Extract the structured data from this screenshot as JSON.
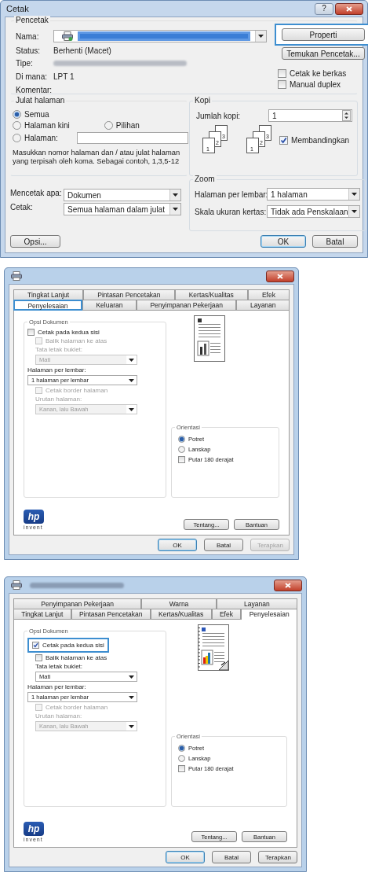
{
  "print_dialog": {
    "title": "Cetak",
    "help_button": "?",
    "printer": {
      "legend": "Pencetak",
      "name_label": "Nama:",
      "status_label": "Status:",
      "status": "Berhenti (Macet)",
      "type_label": "Tipe:",
      "where_label": "Di mana:",
      "where": "LPT 1",
      "comment_label": "Komentar:"
    },
    "side_buttons": [
      {
        "label": "Properti",
        "callout": true
      },
      {
        "label": "Temukan Pencetak...",
        "callout": false
      }
    ],
    "side_options": [
      {
        "label": "Cetak ke berkas",
        "checked": false
      },
      {
        "label": "Manual duplex",
        "checked": false
      }
    ],
    "page_range": {
      "legend": "Julat halaman",
      "options": [
        {
          "label": "Semua",
          "selected": true
        },
        {
          "label": "Halaman kini",
          "selected": false
        },
        {
          "label": "Pilihan",
          "selected": false
        },
        {
          "label": "Halaman:",
          "selected": false
        }
      ],
      "hint": "Masukkan nomor halaman dan / atau julat halaman yang terpisah oleh koma. Sebagai contoh, 1,3,5-12"
    },
    "copies": {
      "legend": "Kopi",
      "count_label": "Jumlah kopi:",
      "count": "1",
      "stacks": [
        [
          "3",
          "2",
          "1"
        ],
        [
          "3",
          "2",
          "1"
        ]
      ],
      "collate": {
        "label": "Membandingkan",
        "checked": true
      }
    },
    "print_what": [
      {
        "label": "Mencetak apa:",
        "value": "Dokumen"
      },
      {
        "label": "Cetak:",
        "value": "Semua halaman dalam julat"
      }
    ],
    "zoom": {
      "legend": "Zoom",
      "rows": [
        {
          "label": "Halaman per lembar:",
          "value": "1 halaman"
        },
        {
          "label": "Skala ukuran kertas:",
          "value": "Tidak ada Penskalaan"
        }
      ]
    },
    "options_button": "Opsi...",
    "buttons": [
      {
        "label": "OK",
        "default": true
      },
      {
        "label": "Batal",
        "default": false
      }
    ]
  },
  "properties_dialogs": [
    {
      "title_redacted": false,
      "tab_rows": [
        [
          {
            "label": "Tingkat Lanjut",
            "selected": false,
            "callout": false
          },
          {
            "label": "Pintasan Pencetakan",
            "selected": false,
            "callout": false
          },
          {
            "label": "Kertas/Kualitas",
            "selected": false,
            "callout": false
          },
          {
            "label": "Efek",
            "selected": false,
            "callout": false
          }
        ],
        [
          {
            "label": "Penyelesaian",
            "selected": true,
            "callout": true
          },
          {
            "label": "Keluaran",
            "selected": false,
            "callout": false
          },
          {
            "label": "Penyimpanan Pekerjaan",
            "selected": false,
            "callout": false
          },
          {
            "label": "Layanan",
            "selected": false,
            "callout": false
          }
        ]
      ],
      "doc_options": {
        "legend": "Opsi Dokumen",
        "items": [
          {
            "kind": "checkbox",
            "label": "Cetak pada kedua sisi",
            "checked": false,
            "disabled": false,
            "callout": false,
            "children": [
              {
                "kind": "checkbox",
                "label": "Balik halaman ke atas",
                "checked": false,
                "disabled": true
              },
              {
                "kind": "label",
                "label": "Tata letak buklet:",
                "disabled": true
              },
              {
                "kind": "select",
                "value": "Mati",
                "disabled": true
              }
            ]
          },
          {
            "kind": "label",
            "label": "Halaman per lembar:",
            "disabled": false
          },
          {
            "kind": "select",
            "value": "1 halaman per lembar",
            "disabled": false,
            "children": [
              {
                "kind": "checkbox",
                "label": "Cetak border halaman",
                "checked": false,
                "disabled": true
              },
              {
                "kind": "label",
                "label": "Urutan halaman:",
                "disabled": true
              },
              {
                "kind": "select",
                "value": "Kanan, lalu Bawah",
                "disabled": true
              }
            ]
          }
        ]
      },
      "preview": {
        "kind": "mono"
      },
      "orientation": {
        "legend": "Orientasi",
        "options": [
          {
            "label": "Potret",
            "selected": true
          },
          {
            "label": "Lanskap",
            "selected": false
          }
        ],
        "rotate": {
          "label": "Putar 180 derajat",
          "checked": false
        }
      },
      "logo": {
        "mark": "hp",
        "tagline": "invent"
      },
      "info_buttons": [
        "Tentang...",
        "Bantuan"
      ],
      "buttons": [
        {
          "label": "OK",
          "default": true,
          "disabled": false
        },
        {
          "label": "Batal",
          "default": false,
          "disabled": false
        },
        {
          "label": "Terapkan",
          "default": false,
          "disabled": true
        }
      ]
    },
    {
      "title_redacted": true,
      "tab_rows": [
        [
          {
            "label": "Penyimpanan Pekerjaan",
            "selected": false,
            "callout": false
          },
          {
            "label": "Warna",
            "selected": false,
            "callout": false
          },
          {
            "label": "Layanan",
            "selected": false,
            "callout": false
          }
        ],
        [
          {
            "label": "Tingkat Lanjut",
            "selected": false,
            "callout": false
          },
          {
            "label": "Pintasan Pencetakan",
            "selected": false,
            "callout": false
          },
          {
            "label": "Kertas/Kualitas",
            "selected": false,
            "callout": false
          },
          {
            "label": "Efek",
            "selected": false,
            "callout": false
          },
          {
            "label": "Penyelesaian",
            "selected": true,
            "callout": false
          }
        ]
      ],
      "doc_options": {
        "legend": "Opsi Dokumen",
        "items": [
          {
            "kind": "checkbox",
            "label": "Cetak pada kedua sisi",
            "checked": true,
            "disabled": false,
            "callout": true,
            "children": [
              {
                "kind": "checkbox",
                "label": "Balik halaman ke atas",
                "checked": false,
                "disabled": false
              },
              {
                "kind": "label",
                "label": "Tata letak buklet:",
                "disabled": false
              },
              {
                "kind": "select",
                "value": "Mati",
                "disabled": false
              }
            ]
          },
          {
            "kind": "label",
            "label": "Halaman per lembar:",
            "disabled": false
          },
          {
            "kind": "select",
            "value": "1 halaman per lembar",
            "disabled": false,
            "children": [
              {
                "kind": "checkbox",
                "label": "Cetak border halaman",
                "checked": false,
                "disabled": true
              },
              {
                "kind": "label",
                "label": "Urutan halaman:",
                "disabled": true
              },
              {
                "kind": "select",
                "value": "Kanan, lalu Bawah",
                "disabled": true
              }
            ]
          }
        ]
      },
      "preview": {
        "kind": "color_duplex"
      },
      "orientation": {
        "legend": "Orientasi",
        "options": [
          {
            "label": "Potret",
            "selected": true
          },
          {
            "label": "Lanskap",
            "selected": false
          }
        ],
        "rotate": {
          "label": "Putar 180 derajat",
          "checked": false
        }
      },
      "logo": {
        "mark": "hp",
        "tagline": "invent"
      },
      "info_buttons": [
        "Tentang...",
        "Bantuan"
      ],
      "buttons": [
        {
          "label": "OK",
          "default": true,
          "disabled": false
        },
        {
          "label": "Batal",
          "default": false,
          "disabled": false
        },
        {
          "label": "Terapkan",
          "default": false,
          "disabled": false
        }
      ]
    }
  ]
}
